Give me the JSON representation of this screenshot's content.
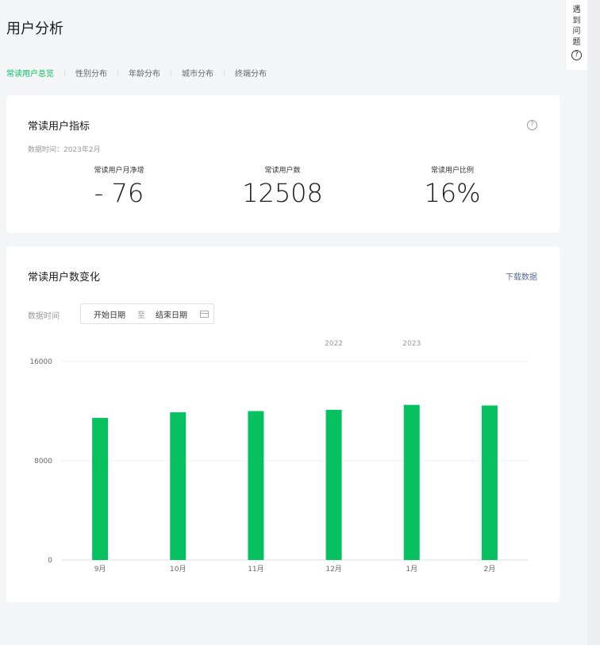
{
  "page": {
    "title": "用户分析"
  },
  "tabs": [
    {
      "label": "常读用户总览",
      "active": true
    },
    {
      "label": "性别分布",
      "active": false
    },
    {
      "label": "年龄分布",
      "active": false
    },
    {
      "label": "城市分布",
      "active": false
    },
    {
      "label": "终端分布",
      "active": false
    }
  ],
  "help_float": {
    "chars": [
      "遇",
      "到",
      "问",
      "题"
    ],
    "icon": "?"
  },
  "metrics_card": {
    "title": "常读用户指标",
    "help_icon": "?",
    "data_time": "数据时间：2023年2月",
    "metrics": [
      {
        "label": "常读用户月净增",
        "value": "- 76"
      },
      {
        "label": "常读用户数",
        "value": "12508"
      },
      {
        "label": "常读用户比例",
        "value": "16%"
      }
    ]
  },
  "trend_card": {
    "title": "常读用户数变化",
    "download": "下载数据",
    "date_label": "数据时间",
    "start_placeholder": "开始日期",
    "range_sep": "至",
    "end_placeholder": "结束日期"
  },
  "colors": {
    "accent": "#07c160",
    "link": "#576b95"
  },
  "chart_data": {
    "type": "bar",
    "categories": [
      "9月",
      "10月",
      "11月",
      "12月",
      "1月",
      "2月"
    ],
    "values": [
      11450,
      11900,
      12000,
      12100,
      12500,
      12450
    ],
    "year_labels": [
      {
        "text": "2022",
        "at": "12月"
      },
      {
        "text": "2023",
        "at": "1月"
      }
    ],
    "y_ticks": [
      0,
      8000,
      16000
    ],
    "ylim": [
      0,
      16000
    ],
    "grid": true,
    "color": "#07c160"
  }
}
